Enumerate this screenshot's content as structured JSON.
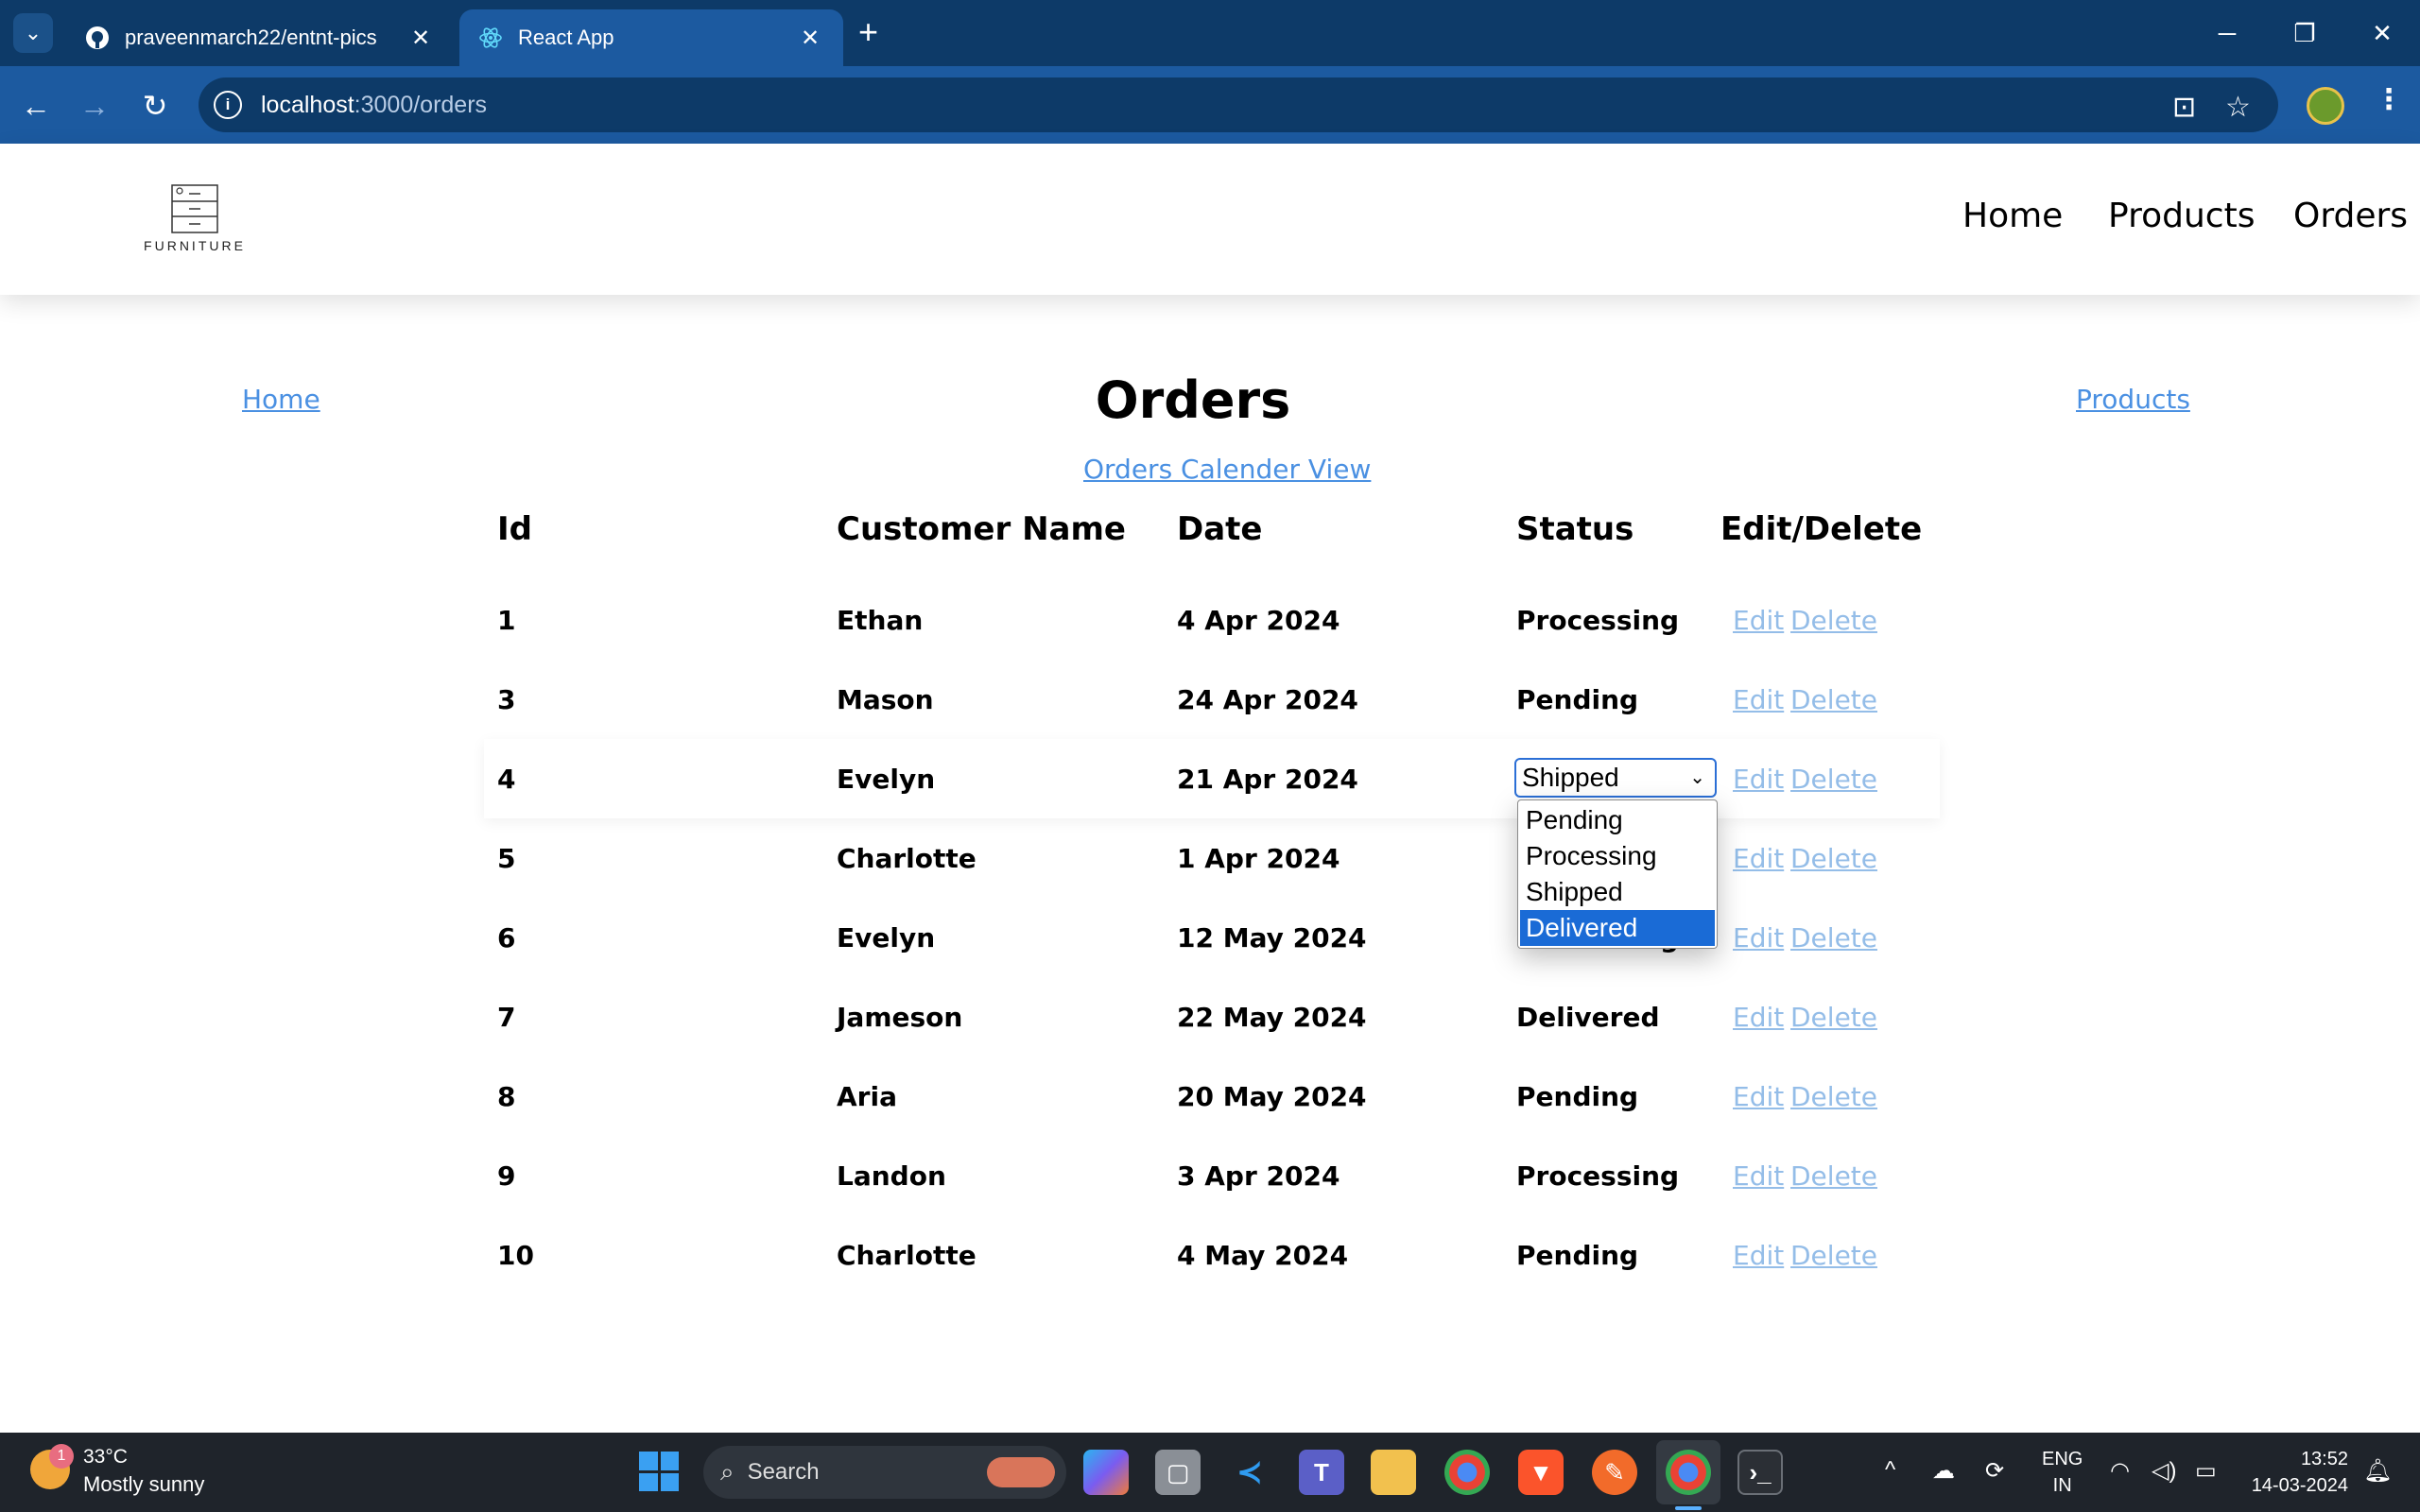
{
  "browser": {
    "tabs": [
      {
        "title": "praveenmarch22/entnt-pics",
        "icon": "github-icon",
        "active": false
      },
      {
        "title": "React App",
        "icon": "react-icon",
        "active": true
      }
    ],
    "url_host": "localhost",
    "url_path": ":3000/orders"
  },
  "site": {
    "logo_text": "FURNITURE",
    "nav": [
      "Home",
      "Products",
      "Orders"
    ]
  },
  "page": {
    "title": "Orders",
    "home_link": "Home",
    "products_link": "Products",
    "calendar_link": "Orders Calender View"
  },
  "table": {
    "headers": [
      "Id",
      "Customer Name",
      "Date",
      "Status",
      "Edit/Delete"
    ],
    "edit_label": "Edit",
    "delete_label": "Delete",
    "rows": [
      {
        "id": "1",
        "name": "Ethan",
        "date": "4 Apr 2024",
        "status": "Processing"
      },
      {
        "id": "3",
        "name": "Mason",
        "date": "24 Apr 2024",
        "status": "Pending"
      },
      {
        "id": "4",
        "name": "Evelyn",
        "date": "21 Apr 2024",
        "status": "Shipped"
      },
      {
        "id": "5",
        "name": "Charlotte",
        "date": "1 Apr 2024",
        "status": ""
      },
      {
        "id": "6",
        "name": "Evelyn",
        "date": "12 May 2024",
        "status": "Processing"
      },
      {
        "id": "7",
        "name": "Jameson",
        "date": "22 May 2024",
        "status": "Delivered"
      },
      {
        "id": "8",
        "name": "Aria",
        "date": "20 May 2024",
        "status": "Pending"
      },
      {
        "id": "9",
        "name": "Landon",
        "date": "3 Apr 2024",
        "status": "Processing"
      },
      {
        "id": "10",
        "name": "Charlotte",
        "date": "4 May 2024",
        "status": "Pending"
      }
    ],
    "editing_row_index": 2
  },
  "status_dropdown": {
    "value": "Shipped",
    "options": [
      "Pending",
      "Processing",
      "Shipped",
      "Delivered"
    ],
    "highlighted": "Delivered"
  },
  "taskbar": {
    "weather_badge": "1",
    "weather_temp": "33°C",
    "weather_desc": "Mostly sunny",
    "search_placeholder": "Search",
    "lang_line1": "ENG",
    "lang_line2": "IN",
    "time": "13:52",
    "date": "14-03-2024"
  },
  "colors": {
    "tab_strip": "#0d3a68",
    "toolbar": "#1c5aa0",
    "link": "#4a90e2",
    "action_link": "#94bde8",
    "option_highlight": "#1a6bd6",
    "taskbar": "#1f242b"
  }
}
